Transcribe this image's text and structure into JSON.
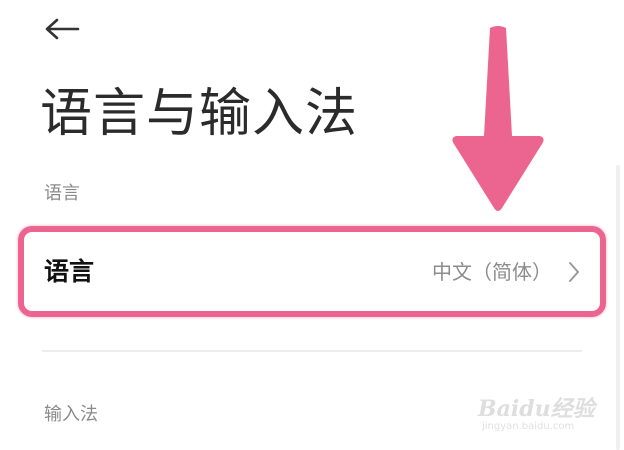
{
  "header": {
    "back_icon": "arrow-left-icon",
    "title": "语言与输入法"
  },
  "sections": {
    "language_header": "语言",
    "input_header": "输入法"
  },
  "language_row": {
    "label": "语言",
    "value": "中文（简体）",
    "chevron_icon": "chevron-right-icon"
  },
  "annotation": {
    "color": "#ec6591",
    "arrow_icon": "arrow-down-icon"
  },
  "watermark": {
    "brand": "Baidu经验",
    "url": "jingyan.baidu.com"
  }
}
